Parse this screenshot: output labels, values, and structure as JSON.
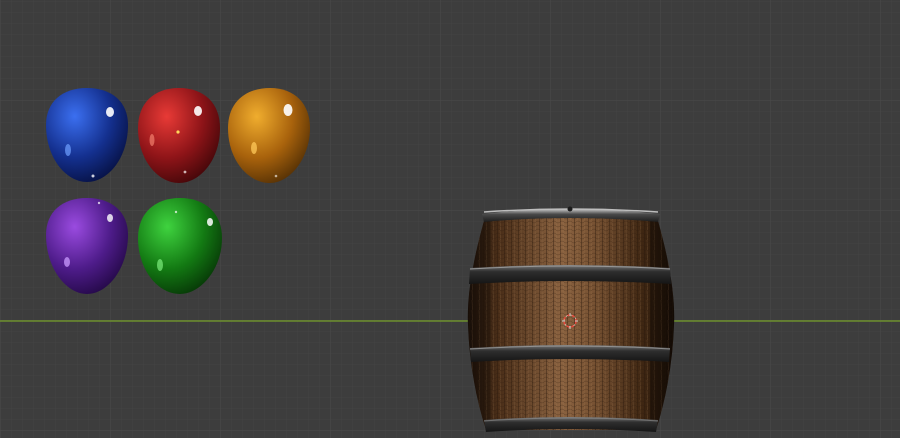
{
  "viewport": {
    "background_color": "#3d3d3d",
    "grid_minor_color": "#444444",
    "grid_major_color": "#4a4a4a",
    "x_axis_color": "#6d8f2c"
  },
  "gems": [
    {
      "name": "blue-gem",
      "color_light": "#2f5fd8",
      "color_dark": "#0a1a5e"
    },
    {
      "name": "red-gem",
      "color_light": "#d8282a",
      "color_dark": "#5c0a0d"
    },
    {
      "name": "orange-gem",
      "color_light": "#e09c24",
      "color_dark": "#7a4a08"
    },
    {
      "name": "purple-gem",
      "color_light": "#8a3bd0",
      "color_dark": "#3a0f6a"
    },
    {
      "name": "green-gem",
      "color_light": "#2fbf2f",
      "color_dark": "#0a4a0a"
    }
  ],
  "barrel": {
    "wood_light": "#8a6240",
    "wood_dark": "#3a2412",
    "band_color": "#2a2a2a",
    "band_highlight": "#9a9a9a"
  },
  "cursor_3d": {
    "ring_color": "#e8473a"
  }
}
